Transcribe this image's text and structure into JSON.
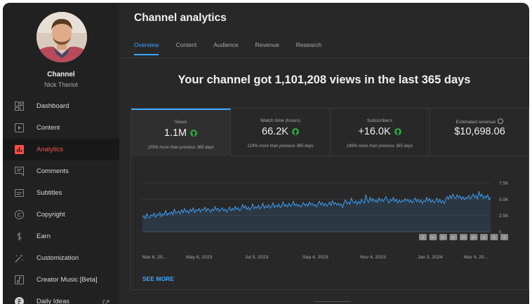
{
  "sidebar": {
    "channel_label": "Channel",
    "channel_name": "Nick Theriot",
    "items": [
      {
        "label": "Dashboard",
        "icon": "dashboard-icon"
      },
      {
        "label": "Content",
        "icon": "content-icon"
      },
      {
        "label": "Analytics",
        "icon": "analytics-icon",
        "active": true
      },
      {
        "label": "Comments",
        "icon": "comments-icon"
      },
      {
        "label": "Subtitles",
        "icon": "subtitles-icon"
      },
      {
        "label": "Copyright",
        "icon": "copyright-icon"
      },
      {
        "label": "Earn",
        "icon": "earn-icon"
      },
      {
        "label": "Customization",
        "icon": "customization-icon"
      },
      {
        "label": "Creator Music [Beta]",
        "icon": "creator-music-icon"
      },
      {
        "label": "Daily Ideas",
        "icon": "daily-ideas-icon"
      }
    ]
  },
  "main": {
    "title": "Channel analytics",
    "tabs": [
      {
        "label": "Overview",
        "active": true
      },
      {
        "label": "Content"
      },
      {
        "label": "Audience"
      },
      {
        "label": "Revenue"
      },
      {
        "label": "Research"
      }
    ],
    "headline": "Your channel got 1,101,208 views in the last 365 days",
    "cards": [
      {
        "label": "Views",
        "value": "1.1M",
        "note": "155% more than previous 365 days"
      },
      {
        "label": "Watch time (hours)",
        "value": "66.2K",
        "note": "124% more than previous 365 days"
      },
      {
        "label": "Subscribers",
        "value": "+16.0K",
        "note": "186% more than previous 365 days"
      },
      {
        "label": "Estimated revenue",
        "value": "$10,698.06",
        "note": ""
      }
    ],
    "see_more": "SEE MORE"
  },
  "colors": {
    "accent": "#3ea6ff",
    "active_nav": "#ff4e45",
    "up_badge": "#2ba640",
    "line": "#3ea6ff"
  },
  "chart_data": {
    "type": "line",
    "x_ticks": [
      "Mar 6, 20...",
      "May 6, 2023",
      "Jul 5, 2023",
      "Sep 4, 2023",
      "Nov 4, 2023",
      "Jan 3, 2024",
      "Mar 4, 20..."
    ],
    "y_ticks": [
      "7.5K",
      "5.0K",
      "2.5K",
      "0"
    ],
    "ylim": [
      0,
      7500
    ],
    "series": [
      {
        "values": [
          2200,
          2500,
          2000,
          2800,
          2300,
          2100,
          2600,
          2400,
          2900,
          2200,
          2700,
          2500,
          3000,
          2300,
          2800,
          2600,
          3300,
          2500,
          2900,
          2700,
          3100,
          2600,
          3500,
          2800,
          3000,
          3200,
          2700,
          3400,
          2900,
          3600,
          3000,
          3300,
          2800,
          3500,
          3100,
          3700,
          2900,
          3400,
          3200,
          3600,
          3000,
          3500,
          3300,
          3800,
          3100,
          3600,
          3400,
          3000,
          3500,
          3200,
          3900,
          3300,
          3600,
          3100,
          3400,
          3700,
          3200,
          3500,
          3000,
          3400,
          3800,
          3200,
          3600,
          3300,
          3900,
          3400,
          3700,
          3200,
          3500,
          4200,
          3600,
          4000,
          3400,
          3800,
          3300,
          3700,
          4300,
          3500,
          3900,
          3600,
          4100,
          3500,
          3800,
          4400,
          3600,
          4000,
          3700,
          4200,
          3600,
          3900,
          4500,
          3700,
          4100,
          3800,
          4300,
          3700,
          4000,
          4600,
          3900,
          4200,
          3800,
          4400,
          3900,
          4100,
          4700,
          4000,
          4300,
          3900,
          4200,
          3800,
          4100,
          4500,
          4000,
          4300,
          3900,
          4600,
          4100,
          4400,
          4000,
          4200,
          3800,
          4300,
          4700,
          4100,
          4500,
          4000,
          4400,
          3900,
          4200,
          4600,
          4000,
          4800,
          4200,
          4500,
          4100,
          4400,
          4000,
          4300,
          3700,
          4500,
          4900,
          4300,
          4600,
          4200,
          5200,
          4600,
          4400,
          4800,
          4200,
          4700,
          4300,
          5000,
          4600,
          4400,
          5700,
          4800,
          4500,
          5300,
          4700,
          5100,
          4600,
          4900,
          4500,
          5200,
          4700,
          5000,
          4600,
          5100,
          5400,
          4800,
          4400,
          5000,
          4700,
          5300,
          4600,
          5000,
          4400,
          4900,
          4500,
          4800,
          4600,
          5100,
          4700,
          5000,
          4500,
          4900,
          4400,
          4800,
          5200,
          4600,
          5000,
          4500,
          4900,
          4300,
          4800,
          4600,
          5300,
          4700,
          5100,
          4500,
          4900,
          4400,
          4700,
          5200,
          4500,
          5000,
          4400,
          4800,
          4300,
          4900,
          5400,
          5000,
          5600,
          5100,
          5800,
          5300,
          5100,
          5700,
          5200,
          5500,
          5000,
          5400,
          4900,
          5300,
          5100,
          5600,
          5000,
          5400,
          5800,
          5200,
          5600,
          5000,
          6200,
          5400,
          5800,
          5100,
          5500,
          5200,
          5700,
          4900,
          5300
        ]
      }
    ],
    "marker_labels": [
      "S",
      "S+",
      "S+",
      "S+",
      "S+",
      "S+",
      "S",
      "S",
      "S"
    ],
    "grid": true,
    "area_fill": true
  }
}
